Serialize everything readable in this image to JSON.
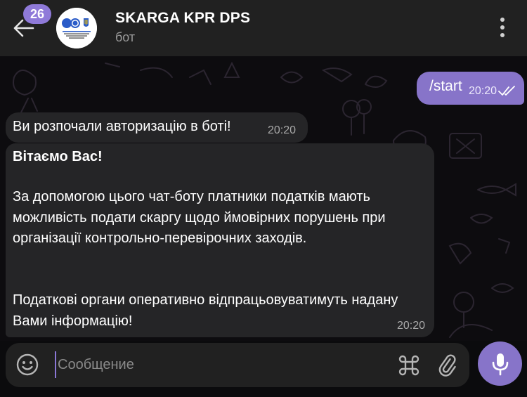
{
  "header": {
    "unread_count": "26",
    "title": "SKARGA KPR DPS",
    "subtitle": "бот",
    "avatar_icon": "ukraine-tax-service-logo"
  },
  "messages": {
    "outgoing": {
      "text": "/start",
      "time": "20:20",
      "status_icon": "double-check-icon"
    },
    "incoming_1": {
      "text": "Ви розпочали авторизацію в боті!",
      "time": "20:20"
    },
    "incoming_2": {
      "greeting": "Вітаємо Вас!",
      "paragraph_1": "За допомогою цього чат-боту платники податків мають можливість подати скаргу щодо ймовірних порушень при організації контрольно-перевірочних заходів.",
      "paragraph_2": "Податкові органи оперативно відпрацьовуватимуть надану Вами інформацію!",
      "time": "20:20"
    }
  },
  "composer": {
    "placeholder": "Сообщение",
    "value": ""
  },
  "colors": {
    "accent": "#8774c9",
    "header_bg": "#212121",
    "bubble_in": "#252527",
    "chat_bg": "#0d0c0f"
  }
}
